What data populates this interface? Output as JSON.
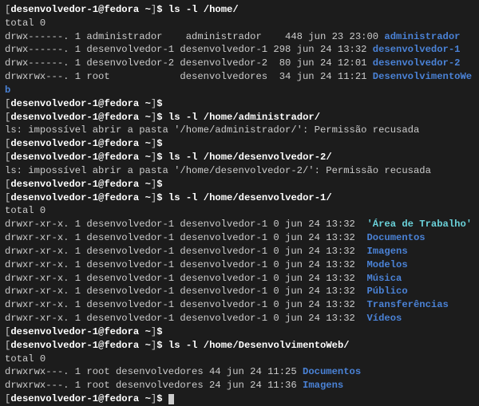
{
  "prompt": {
    "left_bracket": "[",
    "user_host": "desenvolvedor-1@fedora",
    "path_sep": " ",
    "path": "~",
    "right_bracket": "]",
    "symbol": "$"
  },
  "cmds": {
    "c1": "ls -l /home/",
    "c2": "",
    "c3": "ls -l /home/administrador/",
    "c4": "",
    "c5": "ls -l /home/desenvolvedor-2/",
    "c6": "",
    "c7": "ls -l /home/desenvolvedor-1/",
    "c8": "",
    "c9": "ls -l /home/DesenvolvimentoWeb/"
  },
  "out": {
    "total0_a": "total 0",
    "home_l1_p": "drwx------. 1 administrador    administrador    448 jun 23 23:00 ",
    "home_l1_n": "administrador",
    "home_l2_p": "drwx------. 1 desenvolvedor-1 desenvolvedor-1 298 jun 24 13:32 ",
    "home_l2_n": "desenvolvedor-1",
    "home_l3_p": "drwx------. 1 desenvolvedor-2 desenvolvedor-2  80 jun 24 12:01 ",
    "home_l3_n": "desenvolvedor-2",
    "home_l4_p": "drwxrwx---. 1 root            desenvolvedores  34 jun 24 11:21 ",
    "home_l4_n": "DesenvolvimentoWe",
    "home_l4_wrap": "b",
    "err_admin": "ls: impossível abrir a pasta '/home/administrador/': Permissão recusada",
    "err_dev2": "ls: impossível abrir a pasta '/home/desenvolvedor-2/': Permissão recusada",
    "total0_b": "total 0",
    "dev1_pfx": "drwxr-xr-x. 1 desenvolvedor-1 desenvolvedor-1 0 jun 24 13:32  ",
    "dev1_n1": "'Área de Trabalho'",
    "dev1_n2": "Documentos",
    "dev1_n3": "Imagens",
    "dev1_n4": "Modelos",
    "dev1_n5": "Música",
    "dev1_n6": "Público",
    "dev1_n7": "Transferências",
    "dev1_n8": "Vídeos",
    "total0_c": "total 0",
    "web_l1_p": "drwxrwx---. 1 root desenvolvedores 44 jun 24 11:25 ",
    "web_l1_n": "Documentos",
    "web_l2_p": "drwxrwx---. 1 root desenvolvedores 24 jun 24 11:36 ",
    "web_l2_n": "Imagens"
  }
}
